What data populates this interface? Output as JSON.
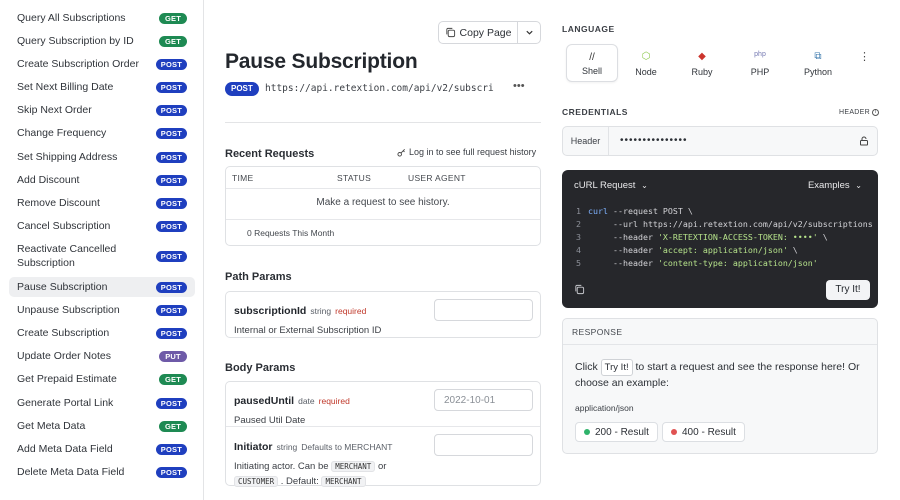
{
  "sidebar": {
    "items": [
      {
        "label": "Query All Subscriptions",
        "method": "GET"
      },
      {
        "label": "Query Subscription by ID",
        "method": "GET"
      },
      {
        "label": "Create Subscription Order",
        "method": "POST"
      },
      {
        "label": "Set Next Billing Date",
        "method": "POST"
      },
      {
        "label": "Skip Next Order",
        "method": "POST"
      },
      {
        "label": "Change Frequency",
        "method": "POST"
      },
      {
        "label": "Set Shipping Address",
        "method": "POST"
      },
      {
        "label": "Add Discount",
        "method": "POST"
      },
      {
        "label": "Remove Discount",
        "method": "POST"
      },
      {
        "label": "Cancel Subscription",
        "method": "POST"
      },
      {
        "label": "Reactivate Cancelled Subscription",
        "method": "POST"
      },
      {
        "label": "Pause Subscription",
        "method": "POST",
        "active": true
      },
      {
        "label": "Unpause Subscription",
        "method": "POST"
      },
      {
        "label": "Create Subscription",
        "method": "POST"
      },
      {
        "label": "Update Order Notes",
        "method": "PUT"
      },
      {
        "label": "Get Prepaid Estimate",
        "method": "GET"
      },
      {
        "label": "Generate Portal Link",
        "method": "POST"
      },
      {
        "label": "Get Meta Data",
        "method": "GET"
      },
      {
        "label": "Add Meta Data Field",
        "method": "POST"
      },
      {
        "label": "Delete Meta Data Field",
        "method": "POST"
      }
    ]
  },
  "header": {
    "copy_page": "Copy Page",
    "title": "Pause Subscription",
    "method": "POST",
    "url": "https://api.retextion.com/api/v2/subscri"
  },
  "recent_requests": {
    "title": "Recent Requests",
    "login_link": "Log in to see full request history",
    "columns": [
      "TIME",
      "STATUS",
      "USER AGENT"
    ],
    "empty": "Make a request to see history.",
    "footer": "0 Requests This Month"
  },
  "path_params": {
    "title": "Path Params",
    "params": [
      {
        "name": "subscriptionId",
        "type": "string",
        "required": "required",
        "desc": "Internal or External Subscription ID",
        "value": ""
      }
    ]
  },
  "body_params": {
    "title": "Body Params",
    "paused_until": {
      "name": "pausedUntil",
      "type": "date",
      "required": "required",
      "desc": "Paused Util Date",
      "placeholder": "2022-10-01"
    },
    "initiator": {
      "name": "Initiator",
      "type": "string",
      "default_text": "Defaults to MERCHANT",
      "desc_1": "Initiating actor. Can be",
      "chip_1": "MERCHANT",
      "desc_2": "or",
      "chip_2": "CUSTOMER",
      "desc_3": ". Default:",
      "chip_3": "MERCHANT"
    }
  },
  "language": {
    "title": "LANGUAGE",
    "options": [
      {
        "label": "Shell",
        "icon": "//",
        "color": "#333333",
        "active": true
      },
      {
        "label": "Node",
        "icon": "⬡",
        "color": "#8cc84b"
      },
      {
        "label": "Ruby",
        "icon": "◆",
        "color": "#cc342d"
      },
      {
        "label": "PHP",
        "icon": "php",
        "color": "#777bb3"
      },
      {
        "label": "Python",
        "icon": "⧉",
        "color": "#3776ab"
      }
    ]
  },
  "credentials": {
    "title": "CREDENTIALS",
    "header_toggle": "HEADER",
    "label": "Header",
    "value": "•••••••••••••••"
  },
  "code": {
    "language_label": "cURL Request",
    "examples_label": "Examples",
    "lines": [
      {
        "n": "1",
        "kw": "curl",
        "rest": " --request POST \\"
      },
      {
        "n": "2",
        "kw": "",
        "rest": "     --url https://api.retextion.com/api/v2/subscriptions"
      },
      {
        "n": "3",
        "kw": "",
        "rest": "     --header ",
        "str": "'X-RETEXTION-ACCESS-TOKEN: ••••'",
        "tail": " \\"
      },
      {
        "n": "4",
        "kw": "",
        "rest": "     --header ",
        "str": "'accept: application/json'",
        "tail": " \\"
      },
      {
        "n": "5",
        "kw": "",
        "rest": "     --header ",
        "str": "'content-type: application/json'",
        "tail": ""
      }
    ],
    "try_button": "Try It!"
  },
  "response": {
    "title": "RESPONSE",
    "text_before": "Click",
    "try_chip": "Try It!",
    "text_after": "to start a request and see the response here! Or choose an example:",
    "mime": "application/json",
    "results": [
      {
        "label": "200 - Result",
        "color": "#2fb36b"
      },
      {
        "label": "400 - Result",
        "color": "#e05252"
      }
    ]
  },
  "colors": {
    "post": "#1f3fbf",
    "get": "#1e8a53",
    "put": "#6e5aa8"
  }
}
